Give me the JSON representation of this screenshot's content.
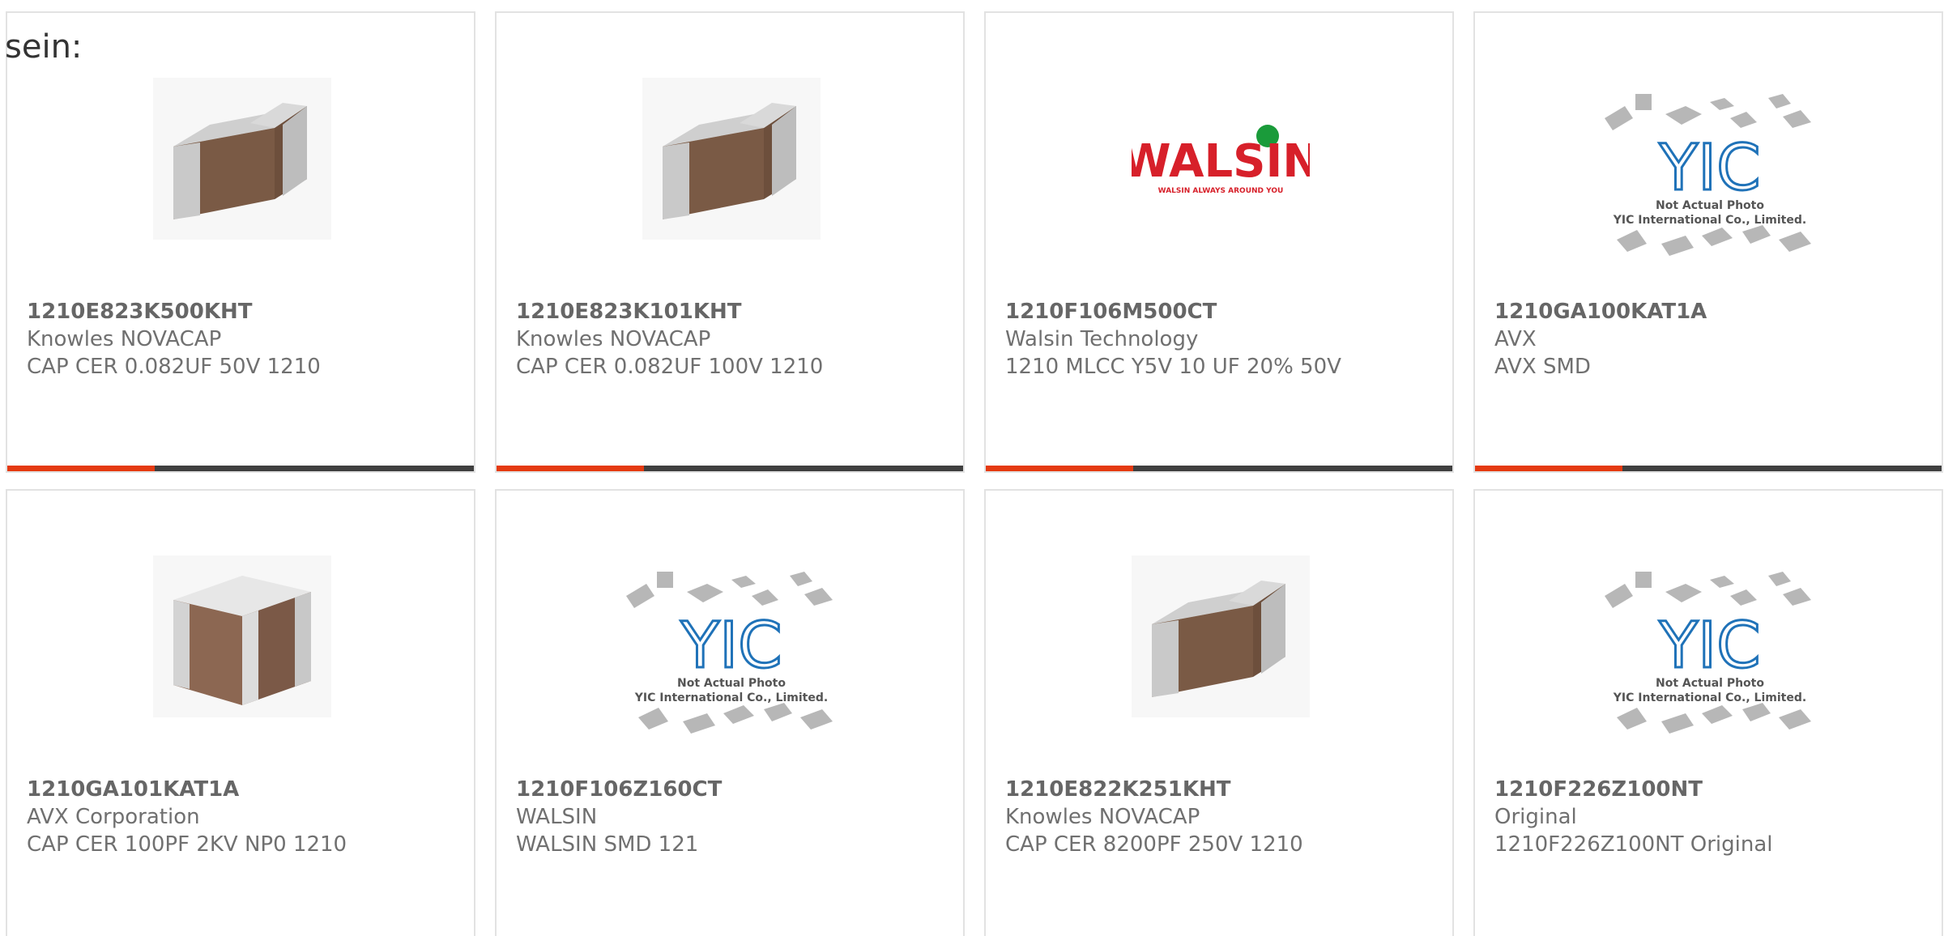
{
  "intro_text": "sein:",
  "colors": {
    "accent": "#e53a10",
    "bar_dark": "#3f3f3f",
    "walsin_red": "#d7202a",
    "walsin_green": "#1a9b3a",
    "yic_blue": "#1f72b8"
  },
  "cards": [
    {
      "part_number": "1210E823K500KHT",
      "manufacturer": "Knowles NOVACAP",
      "description": "CAP CER 0.082UF 50V 1210",
      "image": "chip-capacitor-photo"
    },
    {
      "part_number": "1210E823K101KHT",
      "manufacturer": "Knowles NOVACAP",
      "description": "CAP CER 0.082UF 100V 1210",
      "image": "chip-capacitor-photo"
    },
    {
      "part_number": "1210F106M500CT",
      "manufacturer": "Walsin Technology",
      "description": "1210 MLCC Y5V 10 UF 20% 50V",
      "image": "walsin-logo",
      "logo_text": "WALSIN",
      "logo_tagline": "WALSIN ALWAYS AROUND YOU"
    },
    {
      "part_number": "1210GA100KAT1A",
      "manufacturer": "AVX",
      "description": "AVX SMD",
      "image": "yic-placeholder",
      "logo_text": "YIC",
      "placeholder_line1": "Not Actual Photo",
      "placeholder_line2": "YIC International Co., Limited."
    },
    {
      "part_number": "1210GA101KAT1A",
      "manufacturer": "AVX Corporation",
      "description": "CAP CER 100PF 2KV NP0 1210",
      "image": "chip-capacitor-photo"
    },
    {
      "part_number": "1210F106Z160CT",
      "manufacturer": "WALSIN",
      "description": "WALSIN SMD 121",
      "image": "yic-placeholder",
      "logo_text": "YIC",
      "placeholder_line1": "Not Actual Photo",
      "placeholder_line2": "YIC International Co., Limited."
    },
    {
      "part_number": "1210E822K251KHT",
      "manufacturer": "Knowles NOVACAP",
      "description": "CAP CER 8200PF 250V 1210",
      "image": "chip-capacitor-photo"
    },
    {
      "part_number": "1210F226Z100NT",
      "manufacturer": "Original",
      "description": "1210F226Z100NT Original",
      "image": "yic-placeholder",
      "logo_text": "YIC",
      "placeholder_line1": "Not Actual Photo",
      "placeholder_line2": "YIC International Co., Limited."
    }
  ]
}
